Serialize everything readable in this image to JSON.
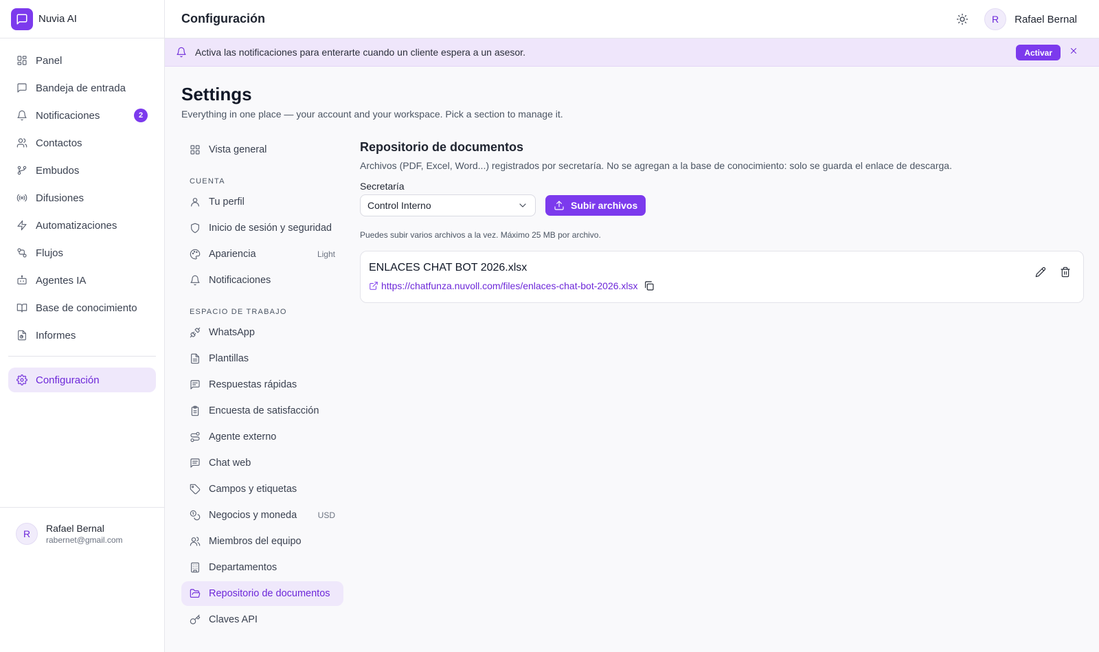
{
  "app": {
    "name": "Nuvia AI",
    "page_title": "Configuración"
  },
  "colors": {
    "accent": "#7c3aed",
    "accent_soft": "#efe8fb",
    "banner_bg": "#efe6fb"
  },
  "sidebar": {
    "items": [
      {
        "label": "Panel",
        "icon": "grid-icon"
      },
      {
        "label": "Bandeja de entrada",
        "icon": "message-icon"
      },
      {
        "label": "Notificaciones",
        "icon": "bell-icon",
        "badge": "2"
      },
      {
        "label": "Contactos",
        "icon": "users-icon"
      },
      {
        "label": "Embudos",
        "icon": "git-branch-icon"
      },
      {
        "label": "Difusiones",
        "icon": "broadcast-icon"
      },
      {
        "label": "Automatizaciones",
        "icon": "zap-icon"
      },
      {
        "label": "Flujos",
        "icon": "workflow-icon"
      },
      {
        "label": "Agentes IA",
        "icon": "bot-icon"
      },
      {
        "label": "Base de conocimiento",
        "icon": "book-icon"
      },
      {
        "label": "Informes",
        "icon": "report-icon"
      }
    ],
    "active_item": {
      "label": "Configuración",
      "icon": "gear-icon"
    },
    "user": {
      "initial": "R",
      "name": "Rafael Bernal",
      "email": "rabernet@gmail.com"
    }
  },
  "topbar": {
    "title": "Configuración",
    "user_initial": "R",
    "user_name": "Rafael Bernal"
  },
  "banner": {
    "text": "Activa las notificaciones para enterarte cuando un cliente espera a un asesor.",
    "button": "Activar"
  },
  "settings": {
    "title": "Settings",
    "subtitle": "Everything in one place — your account and your workspace. Pick a section to manage it.",
    "overview": "Vista general",
    "account_group": "CUENTA",
    "account_items": [
      {
        "label": "Tu perfil",
        "icon": "user-icon"
      },
      {
        "label": "Inicio de sesión y seguridad",
        "icon": "shield-icon"
      },
      {
        "label": "Apariencia",
        "icon": "palette-icon",
        "meta": "Light"
      },
      {
        "label": "Notificaciones",
        "icon": "bell-icon"
      }
    ],
    "workspace_group": "ESPACIO DE TRABAJO",
    "workspace_items": [
      {
        "label": "WhatsApp",
        "icon": "plug-icon"
      },
      {
        "label": "Plantillas",
        "icon": "file-text-icon"
      },
      {
        "label": "Respuestas rápidas",
        "icon": "message-square-text-icon"
      },
      {
        "label": "Encuesta de satisfacción",
        "icon": "clipboard-icon"
      },
      {
        "label": "Agente externo",
        "icon": "route-icon"
      },
      {
        "label": "Chat web",
        "icon": "chat-icon"
      },
      {
        "label": "Campos y etiquetas",
        "icon": "tag-icon"
      },
      {
        "label": "Negocios y moneda",
        "icon": "coins-icon",
        "meta": "USD"
      },
      {
        "label": "Miembros del equipo",
        "icon": "team-icon"
      },
      {
        "label": "Departamentos",
        "icon": "building-icon"
      },
      {
        "label": "Repositorio de documentos",
        "icon": "folder-open-icon",
        "active": true
      },
      {
        "label": "Claves API",
        "icon": "key-icon"
      }
    ]
  },
  "repository": {
    "title": "Repositorio de documentos",
    "description": "Archivos (PDF, Excel, Word...) registrados por secretaría. No se agregan a la base de conocimiento: solo se guarda el enlace de descarga.",
    "field_label": "Secretaría",
    "select_value": "Control Interno",
    "upload_button": "Subir archivos",
    "hint": "Puedes subir varios archivos a la vez. Máximo 25 MB por archivo.",
    "files": [
      {
        "name": "ENLACES CHAT BOT 2026.xlsx",
        "url": "https://chatfunza.nuvoll.com/files/enlaces-chat-bot-2026.xlsx"
      }
    ]
  }
}
